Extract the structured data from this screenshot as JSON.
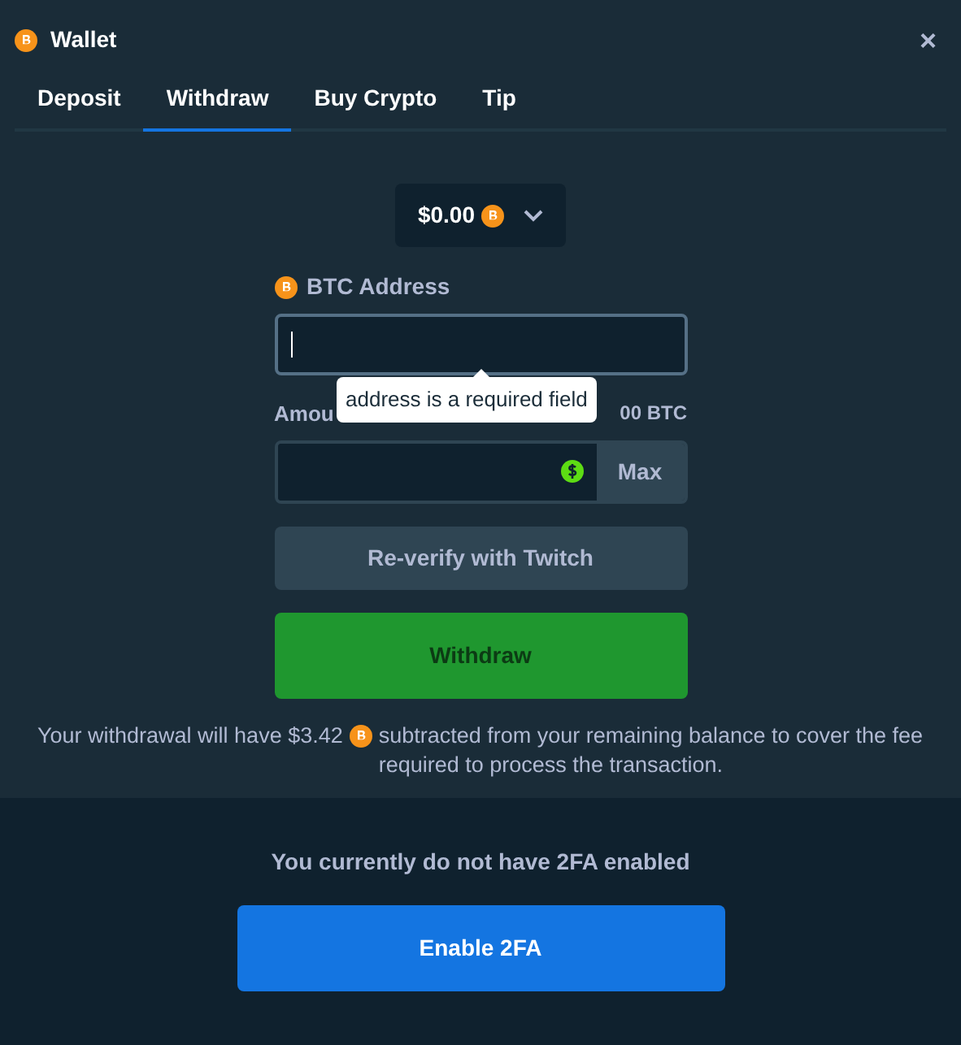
{
  "window": {
    "title": "Wallet",
    "close": "×"
  },
  "tabs": [
    {
      "label": "Deposit",
      "selected": false
    },
    {
      "label": "Withdraw",
      "selected": true
    },
    {
      "label": "Buy Crypto",
      "selected": false
    },
    {
      "label": "Tip",
      "selected": false
    }
  ],
  "balance": {
    "value": "$0.00"
  },
  "address": {
    "label": "BTC Address",
    "tooltip": "address is a required field"
  },
  "amount": {
    "label": "Amou",
    "limit": "00 BTC",
    "button": "Max"
  },
  "reverify_button": "Re-verify with Twitch",
  "withdraw_button": "Withdraw",
  "fee_note": {
    "before": "Your withdrawal will have $3.42",
    "after": "subtracted from your remaining balance to cover the fee required to process the transaction."
  },
  "twofa": {
    "message": "You currently do not have 2FA enabled",
    "button": "Enable 2FA"
  }
}
